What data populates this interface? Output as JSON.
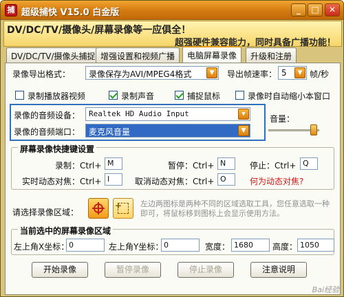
{
  "window": {
    "title": "超级捕快 V15.0 白金版",
    "controls": {
      "minimize": "_",
      "maximize": "□",
      "close": "✕"
    }
  },
  "banner": {
    "line1": "DV/DC/TV/摄像头/屏幕录像等一应俱全！",
    "line2": "超强硬件兼容能力，同时具备广播功能！"
  },
  "tabs": [
    {
      "label": "DV/DC/TV/摄像头捕捉"
    },
    {
      "label": "增强设置和视频广播"
    },
    {
      "label": "电脑屏幕录像",
      "active": true
    },
    {
      "label": "升级和注册"
    }
  ],
  "export": {
    "format_label": "录像导出格式：",
    "format_value": "录像保存为AVI/MPEG4格式",
    "fps_label": "导出帧速率：",
    "fps_value": "5",
    "fps_unit": "帧/秒"
  },
  "options": [
    {
      "label": "录制播放器视频",
      "checked": false
    },
    {
      "label": "录制声音",
      "checked": true
    },
    {
      "label": "捕捉鼠标",
      "checked": true
    },
    {
      "label": "录像时自动缩小本窗口",
      "checked": false
    }
  ],
  "audio": {
    "device_label": "录像的音频设备：",
    "device_value": "Realtek HD Audio Input",
    "port_label": "录像的音频端口：",
    "port_value": "麦克风音量",
    "volume_label": "音量：",
    "volume_level": 0.95
  },
  "hotkeys": {
    "group_title": "屏幕录像快捷键设置",
    "record_label": "录制：Ctrl+",
    "record_key": "M",
    "pause_label": "暂停：Ctrl+",
    "pause_key": "N",
    "stop_label": "停止：Ctrl+",
    "stop_key": "Q",
    "focus_label": "实时动态对焦：Ctrl+",
    "focus_key": "I",
    "cancel_focus_label": "取消动态对焦：Ctrl+",
    "cancel_focus_key": "O",
    "focus_help_link": "何为动态对焦?"
  },
  "region_select": {
    "label": "请选择录像区域：",
    "hint": "左边两图标是两种不同的区域选取工具，您任意选取一种即可，将鼠标移到图标上会显示使用方法。",
    "icon1": "+",
    "icon2": "+"
  },
  "current_region": {
    "group_title": "当前选中的屏幕录像区域",
    "x_label": "左上角X坐标：",
    "x_value": "0",
    "y_label": "左上角Y坐标：",
    "y_value": "0",
    "width_label": "宽度：",
    "width_value": "1680",
    "height_label": "高度：",
    "height_value": "1050"
  },
  "buttons": {
    "start": "开始录像",
    "pause": "暂停录像",
    "stop": "停止录像",
    "help": "注意说明"
  },
  "watermark": "Bai经验"
}
